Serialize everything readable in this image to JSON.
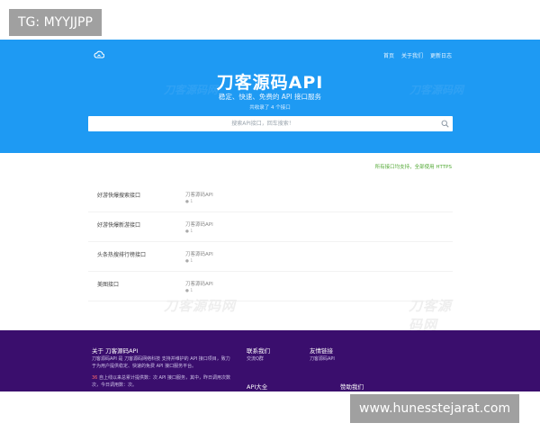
{
  "overlay": {
    "tag": "TG: MYYJJPP",
    "url": "www.hunesstejarat.com"
  },
  "nav": {
    "items": [
      "首页",
      "关于我们",
      "更新日志"
    ]
  },
  "hero": {
    "title": "刀客源码API",
    "subtitle": "稳定、快速、免费的 API 接口服务",
    "count_text": "共收录了 4 个接口",
    "watermark": "刀客源码网"
  },
  "search": {
    "placeholder": "搜索API接口，回车搜索！"
  },
  "notice": "所有接口均支持，全部使用 HTTPS",
  "list": {
    "watermark": "刀客源码网",
    "rows": [
      {
        "name": "好游快爆搜索接口",
        "source": "刀客源码API",
        "meta": "● 1"
      },
      {
        "name": "好游快爆新游接口",
        "source": "刀客源码API",
        "meta": "● 1"
      },
      {
        "name": "头条热搜排行榜接口",
        "source": "刀客源码API",
        "meta": "● 1"
      },
      {
        "name": "美图接口",
        "source": "刀客源码API",
        "meta": "● 1"
      }
    ]
  },
  "footer": {
    "about_title": "关于 刀客源码API",
    "about_line1": "刀客源码API 是 刀客源码网络科技 支持并维护的 API 接口项目，致力",
    "about_line2": "于为用户提供稳定、快速的免费 API 接口服务平台。",
    "stats_num": "36",
    "stats_line1": "自上线以来总累计提供数：次 API 接口服务，其中，昨日调用次数",
    "stats_line2": "次，今日调用数：次。",
    "contact_title": "联系我们",
    "contact_item": "交流Q群",
    "links_title": "友情链接",
    "links_item": "刀客源码API",
    "api_all_title": "API大全",
    "sponsor_title": "赞助我们"
  }
}
